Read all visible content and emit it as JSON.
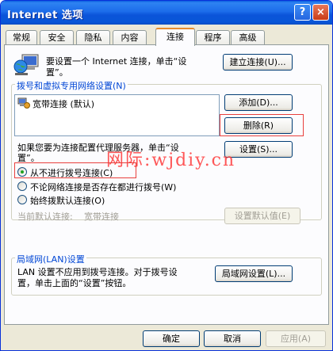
{
  "window": {
    "title": "Internet 选项",
    "help": "?",
    "close": "×"
  },
  "tabs": [
    {
      "label": "常规"
    },
    {
      "label": "安全"
    },
    {
      "label": "隐私"
    },
    {
      "label": "内容"
    },
    {
      "label": "连接",
      "active": true
    },
    {
      "label": "程序"
    },
    {
      "label": "高级"
    }
  ],
  "setup": {
    "text_line1": "要设置一个 Internet 连接，单击“设",
    "text_line2": "置”。",
    "button": "建立连接(U)..."
  },
  "dialup": {
    "legend": "拨号和虚拟专用网络设置(N)",
    "items": [
      {
        "label": "宽带连接 (默认)"
      }
    ],
    "add_button": "添加(D)...",
    "remove_button": "删除(R)",
    "proxy_text_line1": "如果您要为连接配置代理服务器，单击“设",
    "proxy_text_line2": "置”。",
    "settings_button": "设置(S)...",
    "options": [
      {
        "label": "从不进行拨号连接(C)",
        "checked": true
      },
      {
        "label": "不论网络连接是否存在都进行拨号(W)",
        "checked": false
      },
      {
        "label": "始终拨默认连接(O)",
        "checked": false
      }
    ],
    "current_default_label": "当前默认连接:",
    "current_default_value": "宽带连接",
    "set_default_button": "设置默认值(E)"
  },
  "lan": {
    "legend": "局域网(LAN)设置",
    "text_line1": "LAN 设置不应用到拨号连接。对于拨号设",
    "text_line2": "置，单击上面的“设置”按钮。",
    "button": "局域网设置(L)..."
  },
  "footer": {
    "ok": "确定",
    "cancel": "取消",
    "apply": "应用(A)"
  },
  "watermark": "网际:wjdiy.cn",
  "colors": {
    "titlebar": "#0a5ddf",
    "highlight_box": "#e8403d",
    "tab_accent": "#e68b2c"
  }
}
